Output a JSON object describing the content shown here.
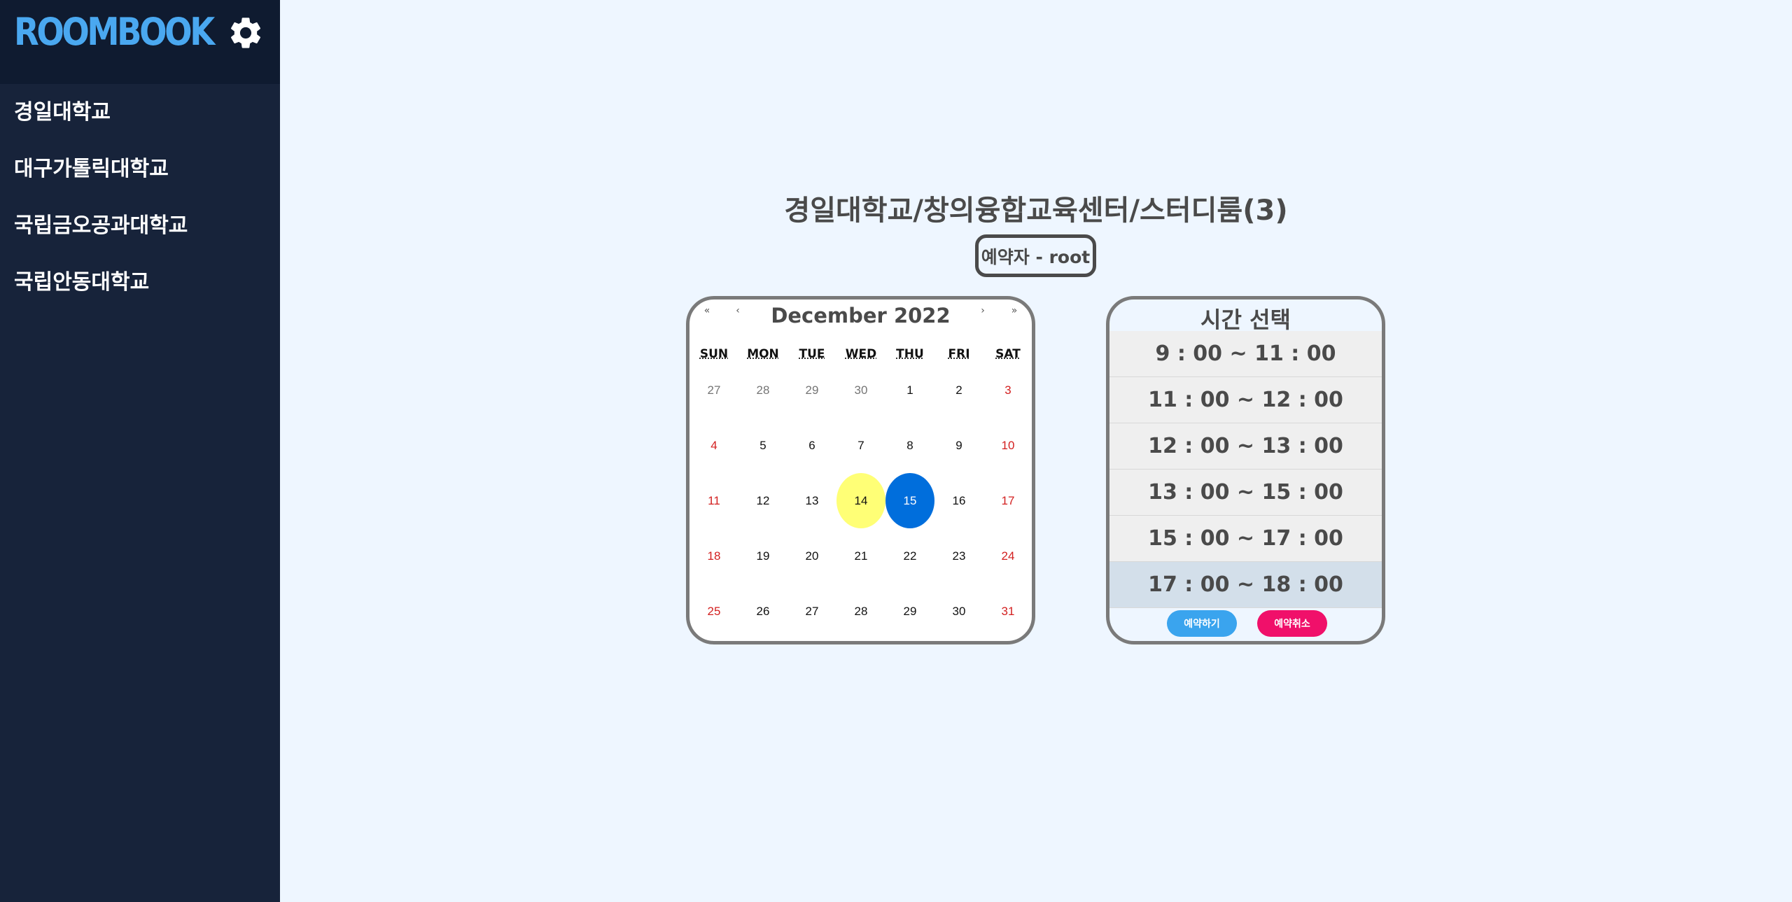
{
  "sidebar": {
    "logo": "ROOMBOOK",
    "settings_icon": "gear-icon",
    "items": [
      {
        "label": "경일대학교"
      },
      {
        "label": "대구가톨릭대학교"
      },
      {
        "label": "국립금오공과대학교"
      },
      {
        "label": "국립안동대학교"
      }
    ]
  },
  "main": {
    "title": "경일대학교/창의융합교육센터/스터디룸(3)",
    "reserver": "예약자 - root"
  },
  "calendar": {
    "month_label": "December 2022",
    "nav": {
      "prev_year": "«",
      "prev_month": "‹",
      "next_month": "›",
      "next_year": "»"
    },
    "weekdays": [
      "SUN",
      "MON",
      "TUE",
      "WED",
      "THU",
      "FRI",
      "SAT"
    ],
    "days": [
      "27",
      "28",
      "29",
      "30",
      "1",
      "2",
      "3",
      "4",
      "5",
      "6",
      "7",
      "8",
      "9",
      "10",
      "11",
      "12",
      "13",
      "14",
      "15",
      "16",
      "17",
      "18",
      "19",
      "20",
      "21",
      "22",
      "23",
      "24",
      "25",
      "26",
      "27",
      "28",
      "29",
      "30",
      "31"
    ],
    "today": "14",
    "selected": "15",
    "colors": {
      "today": "#ffff76",
      "selected": "#006edc",
      "weekend": "#d32020"
    }
  },
  "time_panel": {
    "title": "시간 선택",
    "slots": [
      "9 : 00 ~ 11 : 00",
      "11 : 00 ~ 12 : 00",
      "12 : 00 ~ 13 : 00",
      "13 : 00 ~ 15 : 00",
      "15 : 00 ~ 17 : 00",
      "17 : 00 ~ 18 : 00"
    ],
    "active_slot": "17 : 00 ~ 18 : 00",
    "reserve_button": "예약하기",
    "cancel_button": "예약취소"
  }
}
